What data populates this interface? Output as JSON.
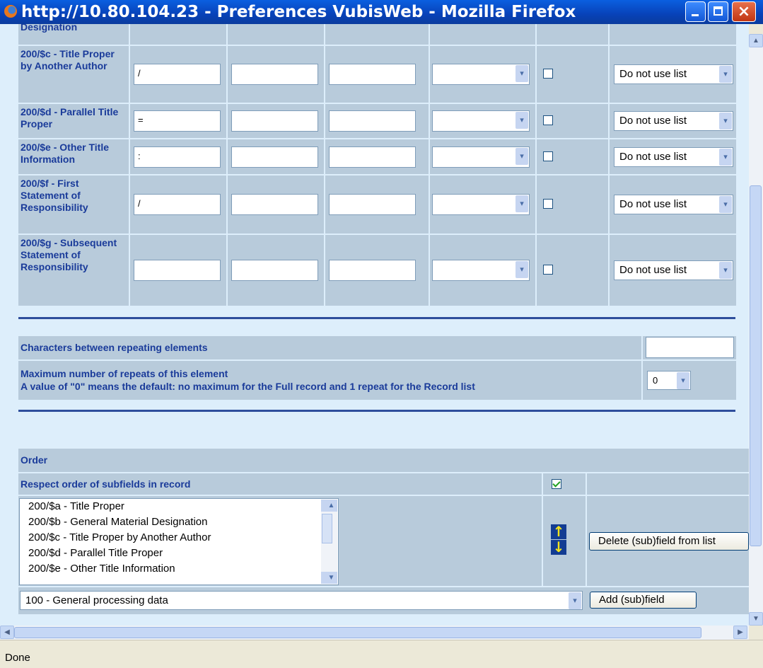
{
  "window": {
    "title": "http://10.80.104.23 - Preferences VubisWeb - Mozilla Firefox"
  },
  "subfields": [
    {
      "label": "200/$c - Title Proper by Another Author",
      "prefix": "/",
      "list_option": "Do not use list"
    },
    {
      "label": "200/$d - Parallel Title Proper",
      "prefix": "=",
      "list_option": "Do not use list"
    },
    {
      "label": "200/$e - Other Title Information",
      "prefix": ":",
      "list_option": "Do not use list"
    },
    {
      "label": "200/$f - First Statement of Responsibility",
      "prefix": "/",
      "list_option": "Do not use list"
    },
    {
      "label": "200/$g - Subsequent Statement of Responsibility",
      "prefix": "",
      "list_option": "Do not use list"
    }
  ],
  "partial_top_label": "Designation",
  "repeat": {
    "chars_label": "Characters between repeating elements",
    "chars_value": "",
    "max_label_line1": "Maximum number of repeats of this element",
    "max_label_line2": "A value of \"0\" means the default: no maximum for the Full record and 1 repeat for the Record list",
    "max_value": "0"
  },
  "order": {
    "header": "Order",
    "respect_label": "Respect order of subfields in record",
    "respect_checked": true,
    "items": [
      "200/$a - Title Proper",
      "200/$b - General Material Designation",
      "200/$c - Title Proper by Another Author",
      "200/$d - Parallel Title Proper",
      "200/$e - Other Title Information"
    ],
    "delete_button": "Delete (sub)field from list",
    "add_select_value": "100 - General processing data",
    "add_button": "Add (sub)field"
  },
  "status": {
    "text": "Done"
  },
  "colors": {
    "label_blue": "#1a3b9a",
    "cell_bg": "#b8cbdb",
    "page_bg": "#ddeefb",
    "rule": "#2e4e9c"
  }
}
